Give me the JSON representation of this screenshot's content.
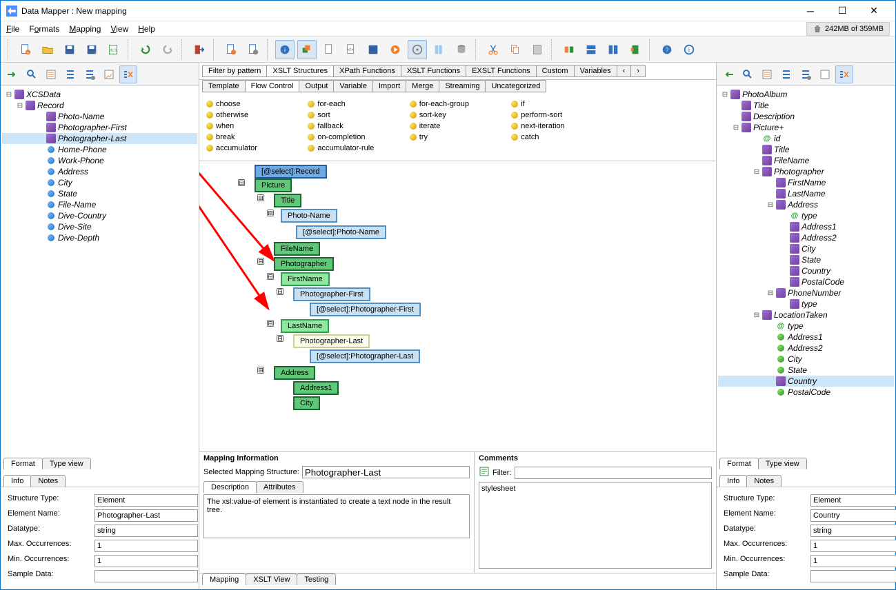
{
  "window": {
    "title": "Data Mapper : New mapping"
  },
  "memory": "242MB of 359MB",
  "menu": {
    "file": "File",
    "formats": "Formats",
    "mapping": "Mapping",
    "view": "View",
    "help": "Help"
  },
  "leftTree": {
    "root": "XCSData",
    "record": "Record",
    "items": [
      "Photo-Name",
      "Photographer-First",
      "Photographer-Last",
      "Home-Phone",
      "Work-Phone",
      "Address",
      "City",
      "State",
      "File-Name",
      "Dive-Country",
      "Dive-Site",
      "Dive-Depth"
    ],
    "selectedIndex": 2
  },
  "leftTabs": {
    "format": "Format",
    "typeview": "Type view"
  },
  "leftInfoTabs": {
    "info": "Info",
    "notes": "Notes"
  },
  "leftInfo": {
    "labels": {
      "structType": "Structure Type:",
      "elemName": "Element Name:",
      "datatype": "Datatype:",
      "maxOcc": "Max. Occurrences:",
      "minOcc": "Min. Occurrences:",
      "sample": "Sample Data:"
    },
    "values": {
      "structType": "Element",
      "elemName": "Photographer-Last",
      "datatype": "string",
      "maxOcc": "1",
      "minOcc": "1",
      "sample": ""
    }
  },
  "centerTopTabs": [
    "Filter by pattern",
    "XSLT Structures",
    "XPath Functions",
    "XSLT Functions",
    "EXSLT Functions",
    "Custom",
    "Variables"
  ],
  "centerTopActiveIndex": 1,
  "centerCatTabs": [
    "Template",
    "Flow Control",
    "Output",
    "Variable",
    "Import",
    "Merge",
    "Streaming",
    "Uncategorized"
  ],
  "centerCatActiveIndex": 1,
  "palette": [
    [
      "choose",
      "for-each",
      "for-each-group",
      "if"
    ],
    [
      "otherwise",
      "sort",
      "sort-key",
      "perform-sort"
    ],
    [
      "when",
      "fallback",
      "iterate",
      "next-iteration"
    ],
    [
      "break",
      "on-completion",
      "try",
      "catch"
    ],
    [
      "accumulator",
      "accumulator-rule",
      "",
      ""
    ]
  ],
  "canvasNodes": {
    "selectRecord": "[@select]:Record",
    "picture": "Picture",
    "title": "Title",
    "photoName": "Photo-Name",
    "selectPhotoName": "[@select]:Photo-Name",
    "fileName": "FileName",
    "photographer": "Photographer",
    "firstName": "FirstName",
    "photographerFirst": "Photographer-First",
    "selectPhotographerFirst": "[@select]:Photographer-First",
    "lastName": "LastName",
    "photographerLast": "Photographer-Last",
    "selectPhotographerLast": "[@select]:Photographer-Last",
    "address": "Address",
    "address1": "Address1",
    "city": "City"
  },
  "mappingInfo": {
    "header": "Mapping Information",
    "selStructLabel": "Selected Mapping Structure:",
    "selStructValue": "Photographer-Last",
    "descTab": "Description",
    "attrTab": "Attributes",
    "description": "The xsl:value-of element is instantiated to create a text node in the result tree."
  },
  "comments": {
    "header": "Comments",
    "filterLabel": "Filter:",
    "content": "stylesheet"
  },
  "footerTabs": [
    "Mapping",
    "XSLT View",
    "Testing"
  ],
  "rightTree": {
    "root": "PhotoAlbum",
    "nodes": [
      {
        "lv": 1,
        "ico": "p",
        "t": "Title"
      },
      {
        "lv": 1,
        "ico": "p",
        "t": "Description"
      },
      {
        "lv": 1,
        "ico": "p",
        "t": "Picture+",
        "exp": true
      },
      {
        "lv": 2,
        "ico": "at",
        "t": "id"
      },
      {
        "lv": 2,
        "ico": "p",
        "t": "Title"
      },
      {
        "lv": 2,
        "ico": "p",
        "t": "FileName"
      },
      {
        "lv": 2,
        "ico": "p",
        "t": "Photographer",
        "exp": true
      },
      {
        "lv": 3,
        "ico": "p",
        "t": "FirstName"
      },
      {
        "lv": 3,
        "ico": "p",
        "t": "LastName"
      },
      {
        "lv": 3,
        "ico": "p",
        "t": "Address",
        "exp": true
      },
      {
        "lv": 4,
        "ico": "at",
        "t": "type"
      },
      {
        "lv": 4,
        "ico": "p",
        "t": "Address1"
      },
      {
        "lv": 4,
        "ico": "p",
        "t": "Address2"
      },
      {
        "lv": 4,
        "ico": "p",
        "t": "City"
      },
      {
        "lv": 4,
        "ico": "p",
        "t": "State"
      },
      {
        "lv": 4,
        "ico": "p",
        "t": "Country"
      },
      {
        "lv": 4,
        "ico": "p",
        "t": "PostalCode"
      },
      {
        "lv": 3,
        "ico": "p",
        "t": "PhoneNumber",
        "exp": true
      },
      {
        "lv": 4,
        "ico": "p",
        "t": "type"
      },
      {
        "lv": 2,
        "ico": "p",
        "t": "LocationTaken",
        "exp": true
      },
      {
        "lv": 3,
        "ico": "at",
        "t": "type"
      },
      {
        "lv": 3,
        "ico": "g",
        "t": "Address1"
      },
      {
        "lv": 3,
        "ico": "g",
        "t": "Address2"
      },
      {
        "lv": 3,
        "ico": "g",
        "t": "City"
      },
      {
        "lv": 3,
        "ico": "g",
        "t": "State"
      },
      {
        "lv": 3,
        "ico": "p",
        "t": "Country",
        "sel": true
      },
      {
        "lv": 3,
        "ico": "g",
        "t": "PostalCode"
      }
    ]
  },
  "rightInfo": {
    "values": {
      "structType": "Element",
      "elemName": "Country",
      "datatype": "string",
      "maxOcc": "1",
      "minOcc": "1",
      "sample": ""
    }
  }
}
